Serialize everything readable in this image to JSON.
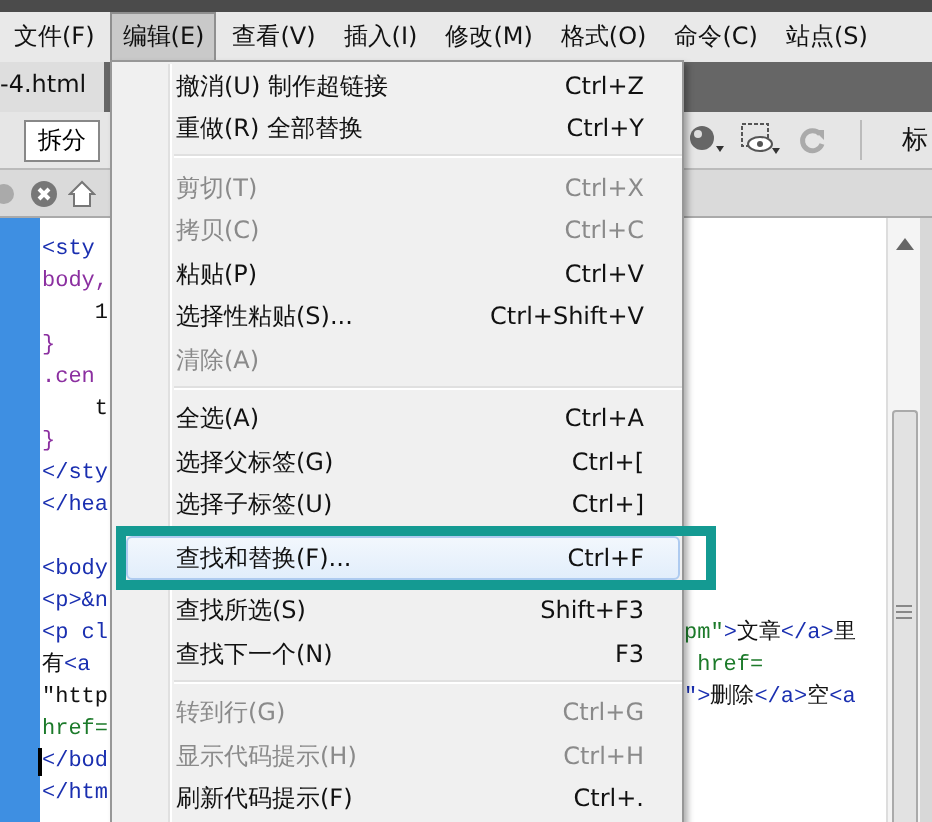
{
  "menubar": [
    {
      "label": "文件(F)",
      "selected": false
    },
    {
      "label": "编辑(E)",
      "selected": true
    },
    {
      "label": "查看(V)",
      "selected": false
    },
    {
      "label": "插入(I)",
      "selected": false
    },
    {
      "label": "修改(M)",
      "selected": false
    },
    {
      "label": "格式(O)",
      "selected": false
    },
    {
      "label": "命令(C)",
      "selected": false
    },
    {
      "label": "站点(S)",
      "selected": false
    }
  ],
  "document_tab": "-4.html",
  "toolbar": {
    "split_button": "拆分",
    "title_label": "标"
  },
  "code_lines": [
    {
      "left": [
        {
          "text": "<sty",
          "kind": "tag"
        }
      ]
    },
    {
      "left": [
        {
          "text": "body,",
          "kind": "css"
        }
      ]
    },
    {
      "left": [
        {
          "text": "    1",
          "kind": "text"
        }
      ]
    },
    {
      "left": [
        {
          "text": "}",
          "kind": "css"
        }
      ]
    },
    {
      "left": [
        {
          "text": ".cen",
          "kind": "css"
        }
      ]
    },
    {
      "left": [
        {
          "text": "    t",
          "kind": "text"
        }
      ]
    },
    {
      "left": [
        {
          "text": "}",
          "kind": "css"
        }
      ]
    },
    {
      "left": [
        {
          "text": "</sty",
          "kind": "tag"
        }
      ]
    },
    {
      "left": [
        {
          "text": "</hea",
          "kind": "tag"
        }
      ]
    },
    {
      "blank": true
    },
    {
      "left": [
        {
          "text": "<body",
          "kind": "tag"
        }
      ]
    },
    {
      "left": [
        {
          "text": "<p>&n",
          "kind": "tag"
        }
      ]
    },
    {
      "left": [
        {
          "text": "<p cl",
          "kind": "tag"
        }
      ],
      "right": [
        {
          "text": "pm\"",
          "kind": "attr"
        },
        {
          "text": ">",
          "kind": "tag"
        },
        {
          "text": "文章",
          "kind": "text"
        },
        {
          "text": "</a>",
          "kind": "tag"
        },
        {
          "text": "里",
          "kind": "text"
        }
      ]
    },
    {
      "left": [
        {
          "text": "有",
          "kind": "text"
        },
        {
          "text": "<a",
          "kind": "tag"
        }
      ],
      "right": [
        {
          "text": " href=",
          "kind": "attr"
        }
      ]
    },
    {
      "left": [
        {
          "text": "\"http",
          "kind": "text"
        }
      ],
      "right": [
        {
          "text": "\">",
          "kind": "tag"
        },
        {
          "text": "删除",
          "kind": "text"
        },
        {
          "text": "</a>",
          "kind": "tag"
        },
        {
          "text": "空",
          "kind": "text"
        },
        {
          "text": "<a",
          "kind": "tag"
        }
      ]
    },
    {
      "left": [
        {
          "text": "href=",
          "kind": "attr"
        }
      ]
    },
    {
      "left": [
        {
          "text": "</bod",
          "kind": "tag"
        }
      ],
      "caret": true
    },
    {
      "left": [
        {
          "text": "</htm",
          "kind": "tag"
        }
      ]
    }
  ],
  "edit_menu": [
    {
      "kind": "item",
      "label": "撤消(U) 制作超链接",
      "shortcut": "Ctrl+Z",
      "disabled": false,
      "selected": false
    },
    {
      "kind": "item",
      "label": "重做(R) 全部替换",
      "shortcut": "Ctrl+Y",
      "disabled": false,
      "selected": false
    },
    {
      "kind": "separator"
    },
    {
      "kind": "item",
      "label": "剪切(T)",
      "shortcut": "Ctrl+X",
      "disabled": true,
      "selected": false
    },
    {
      "kind": "item",
      "label": "拷贝(C)",
      "shortcut": "Ctrl+C",
      "disabled": true,
      "selected": false
    },
    {
      "kind": "item",
      "label": "粘贴(P)",
      "shortcut": "Ctrl+V",
      "disabled": false,
      "selected": false
    },
    {
      "kind": "item",
      "label": "选择性粘贴(S)...",
      "shortcut": "Ctrl+Shift+V",
      "disabled": false,
      "selected": false
    },
    {
      "kind": "item",
      "label": "清除(A)",
      "disabled": true,
      "selected": false
    },
    {
      "kind": "separator"
    },
    {
      "kind": "item",
      "label": "全选(A)",
      "shortcut": "Ctrl+A",
      "disabled": false,
      "selected": false
    },
    {
      "kind": "item",
      "label": "选择父标签(G)",
      "shortcut": "Ctrl+[",
      "disabled": false,
      "selected": false
    },
    {
      "kind": "item",
      "label": "选择子标签(U)",
      "shortcut": "Ctrl+]",
      "disabled": false,
      "selected": false
    },
    {
      "kind": "item",
      "label": "查找和替换(F)...",
      "shortcut": "Ctrl+F",
      "disabled": false,
      "selected": true
    },
    {
      "kind": "item",
      "label": "查找所选(S)",
      "shortcut": "Shift+F3",
      "disabled": false,
      "selected": false
    },
    {
      "kind": "item",
      "label": "查找下一个(N)",
      "shortcut": "F3",
      "disabled": false,
      "selected": false
    },
    {
      "kind": "separator"
    },
    {
      "kind": "item",
      "label": "转到行(G)",
      "shortcut": "Ctrl+G",
      "disabled": true,
      "selected": false
    },
    {
      "kind": "item",
      "label": "显示代码提示(H)",
      "shortcut": "Ctrl+H",
      "disabled": true,
      "selected": false
    },
    {
      "kind": "item",
      "label": "刷新代码提示(F)",
      "shortcut": "Ctrl+.",
      "disabled": false,
      "selected": false
    }
  ]
}
